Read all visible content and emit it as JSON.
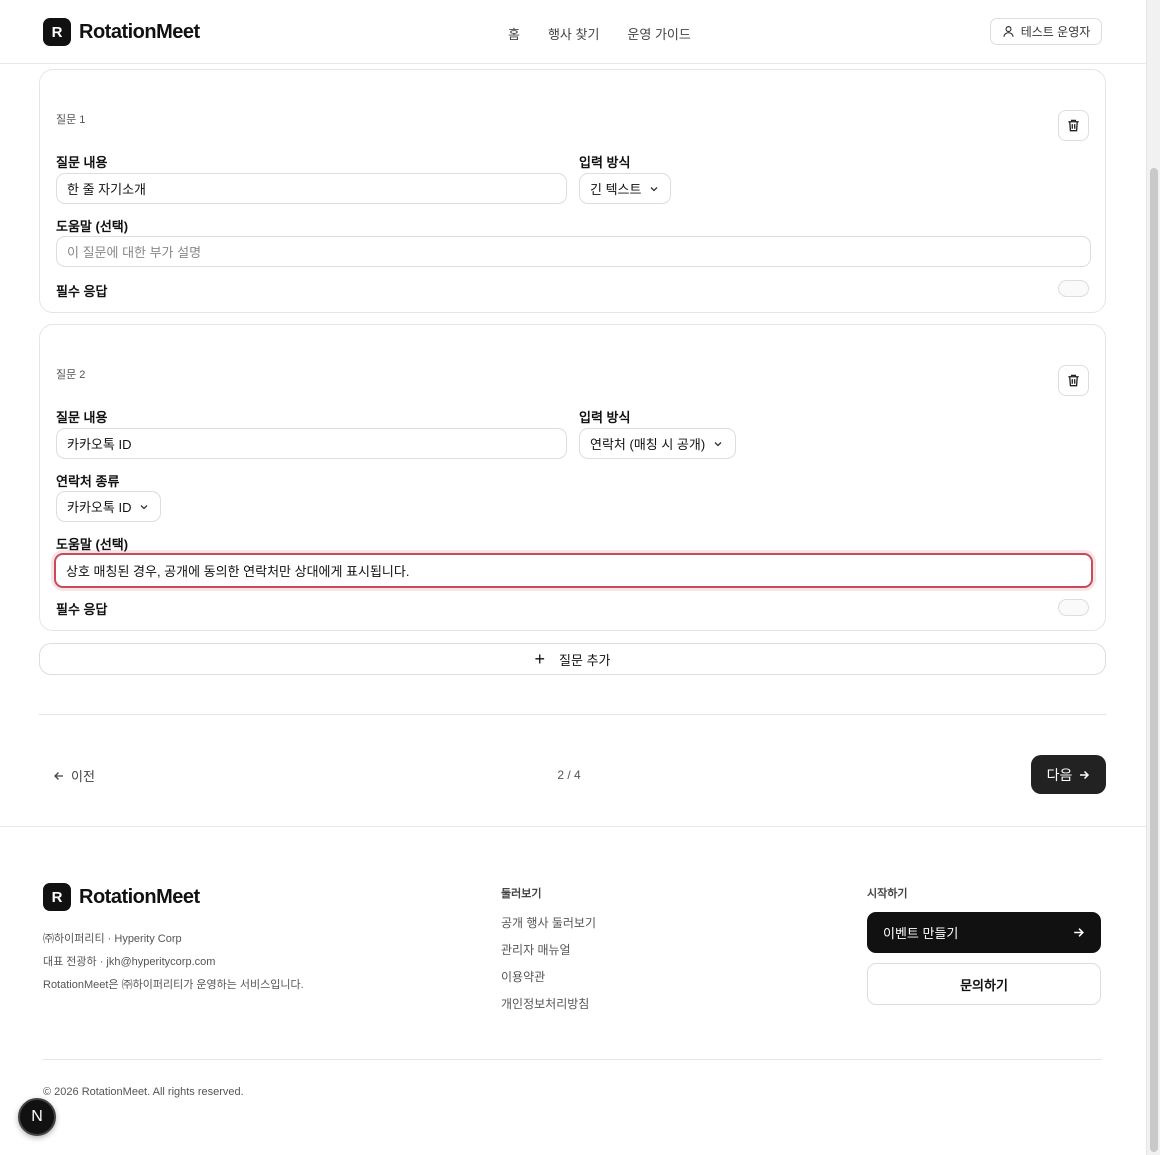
{
  "header": {
    "logo_letter": "R",
    "brand": "RotationMeet",
    "nav": [
      "홈",
      "행사 찾기",
      "운영 가이드"
    ],
    "user": "테스트 운영자"
  },
  "questions": [
    {
      "label": "질문 1",
      "content_label": "질문 내용",
      "content_value": "한 줄 자기소개",
      "type_label": "입력 방식",
      "type_value": "긴 텍스트",
      "help_label": "도움말 (선택)",
      "help_placeholder": "이 질문에 대한 부가 설명",
      "required_label": "필수 응답"
    },
    {
      "label": "질문 2",
      "content_label": "질문 내용",
      "content_value": "카카오톡 ID",
      "type_label": "입력 방식",
      "type_value": "연락처 (매칭 시 공개)",
      "contact_label": "연락처 종류",
      "contact_value": "카카오톡 ID",
      "help_label": "도움말 (선택)",
      "help_value": "상호 매칭된 경우, 공개에 동의한 연락처만 상대에게 표시됩니다.",
      "required_label": "필수 응답"
    }
  ],
  "add_question": "질문 추가",
  "pager": {
    "prev": "이전",
    "indicator": "2 / 4",
    "next": "다음"
  },
  "footer": {
    "logo_letter": "R",
    "brand": "RotationMeet",
    "info": [
      "㈜하이퍼리티 · Hyperity Corp",
      "대표 전광하 · jkh@hyperitycorp.com",
      "RotationMeet은 ㈜하이퍼리티가 운영하는 서비스입니다."
    ],
    "browse_title": "둘러보기",
    "browse_links": [
      "공개 행사 둘러보기",
      "관리자 매뉴얼",
      "이용약관",
      "개인정보처리방침"
    ],
    "start_title": "시작하기",
    "create_event": "이벤트 만들기",
    "contact": "문의하기",
    "copyright": "© 2026 RotationMeet. All rights reserved."
  },
  "badge": "N"
}
